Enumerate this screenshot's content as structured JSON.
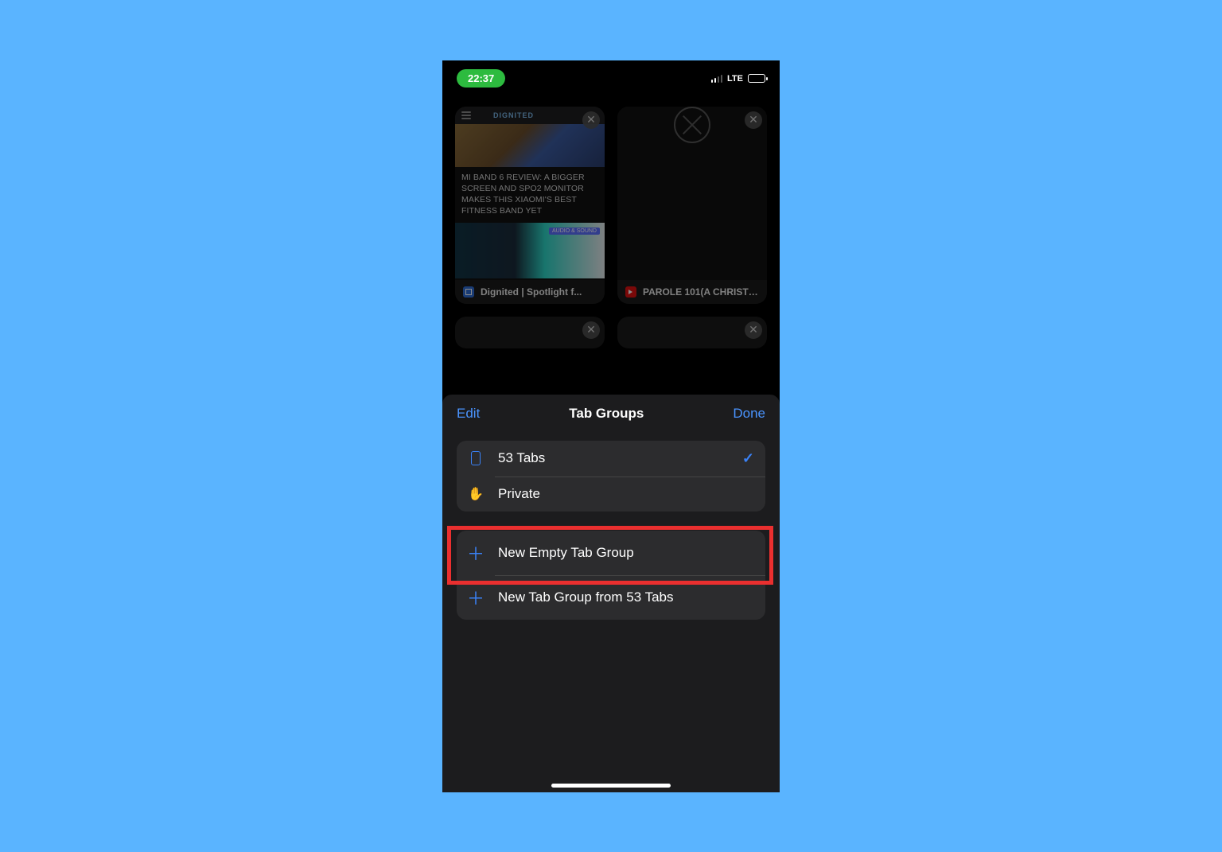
{
  "status": {
    "time": "22:37",
    "network": "LTE"
  },
  "tabs": [
    {
      "title": "Dignited | Spotlight f...",
      "article_text": "MI BAND 6 REVIEW: A BIGGER SCREEN AND SPO2 MONITOR MAKES THIS XIAOMI'S BEST FITNESS BAND YET",
      "badge": "AUDIO & SOUND",
      "brand_name": "DIGNITED"
    },
    {
      "title": "PAROLE 101(A CHRISTIA..."
    }
  ],
  "sheet": {
    "edit": "Edit",
    "title": "Tab Groups",
    "done": "Done",
    "rows": {
      "tabs": "53 Tabs",
      "private": "Private",
      "new_empty": "New Empty Tab Group",
      "new_from": "New Tab Group from 53 Tabs"
    }
  }
}
